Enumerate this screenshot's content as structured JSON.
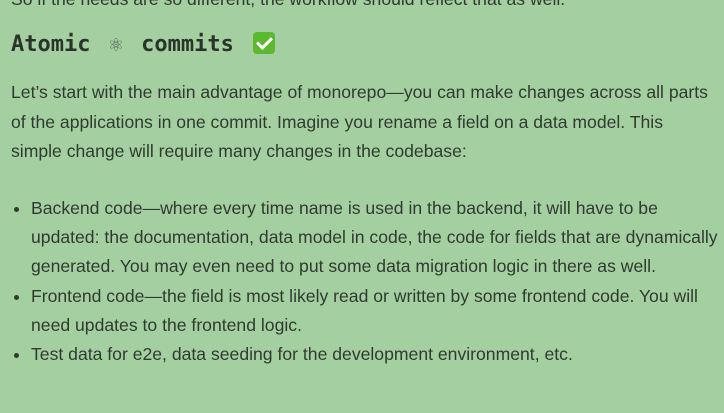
{
  "article": {
    "clipped_top_line": "So if the needs are so different, the workflow should reflect that as well.",
    "heading": {
      "word1": "Atomic",
      "atom_symbol": "⚛",
      "word2": "commits",
      "check_icon": "check-mark-button-icon"
    },
    "intro": "Let’s start with the main advantage of monorepo—you can make changes across all parts of the applications in one commit. Imagine you rename a field on a data model. This simple change will require many changes in the codebase:",
    "bullets": [
      "Backend code—where every time name is used in the backend, it will have to be updated: the documentation, data model in code, the code for fields that are dynamically generated. You may even need to put some data migration logic in there as well.",
      "Frontend code—the field is most likely read or written by some frontend code. You will need updates to the frontend logic.",
      "Test data for e2e, data seeding for the development environment, etc."
    ]
  },
  "colors": {
    "background": "#a4cfa1",
    "text": "#2f3b2f",
    "check_green": "#5cb82e"
  }
}
